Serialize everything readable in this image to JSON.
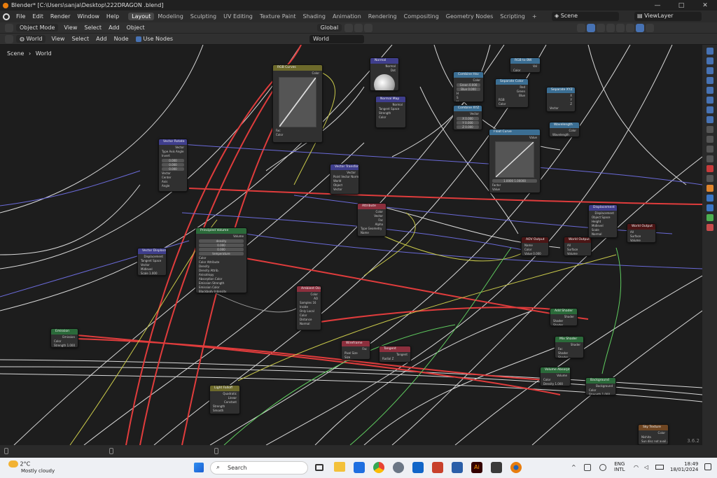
{
  "window": {
    "title": "Blender* [C:\\Users\\sanja\\Desktop\\222DRAGON .blend]",
    "controls": [
      "—",
      "□",
      "✕"
    ]
  },
  "menu": [
    "File",
    "Edit",
    "Render",
    "Window",
    "Help"
  ],
  "workspaces": [
    "Layout",
    "Modeling",
    "Sculpting",
    "UV Editing",
    "Texture Paint",
    "Shading",
    "Animation",
    "Rendering",
    "Compositing",
    "Geometry Nodes",
    "Scripting",
    "+"
  ],
  "active_workspace": "Layout",
  "scene_name": "Scene",
  "view_layer": "ViewLayer",
  "header1": {
    "mode": "Object Mode",
    "items": [
      "View",
      "Select",
      "Add",
      "Object"
    ],
    "orientation": "Global"
  },
  "header2": {
    "shader_type": "World",
    "items": [
      "View",
      "Select",
      "Add",
      "Node"
    ],
    "use_nodes_label": "Use Nodes",
    "world_name": "World"
  },
  "breadcrumb": [
    "Scene",
    "World"
  ],
  "nodes": [
    {
      "id": "rgb-curves",
      "title": "RGB Curves",
      "kind": "h-color",
      "outputs": [
        "Color"
      ],
      "inputs": [
        "Fac",
        "Color"
      ]
    },
    {
      "id": "normal",
      "title": "Normal",
      "kind": "h-vec",
      "outputs": [
        "Normal",
        "Dot"
      ],
      "inputs": [
        "Normal"
      ]
    },
    {
      "id": "normal-map",
      "title": "Normal Map",
      "kind": "h-vec",
      "outputs": [
        "Normal"
      ],
      "fields": [
        "Tangent Space"
      ],
      "inputs": [
        "Strength",
        "Color"
      ]
    },
    {
      "id": "combine-hsv",
      "title": "Combine Hsv",
      "kind": "h-conv",
      "outputs": [
        "Color"
      ],
      "inputs": [
        "H",
        "S",
        "V"
      ],
      "values": [
        "Green  0.000",
        "Blue  0.000"
      ]
    },
    {
      "id": "rgb-bw",
      "title": "RGB to BW",
      "kind": "h-conv",
      "outputs": [
        "Val"
      ],
      "inputs": [
        "Color"
      ]
    },
    {
      "id": "separate-color",
      "title": "Separate Color",
      "kind": "h-conv",
      "outputs": [
        "Red",
        "Green",
        "Blue"
      ],
      "fields": [
        "RGB"
      ],
      "inputs": [
        "Color"
      ]
    },
    {
      "id": "separate-xyz",
      "title": "Separate XYZ",
      "kind": "h-conv",
      "outputs": [
        "X",
        "Y",
        "Z"
      ],
      "inputs": [
        "Vector"
      ]
    },
    {
      "id": "combine-xyz",
      "title": "Combine XYZ",
      "kind": "h-conv",
      "outputs": [
        "Vector"
      ],
      "values": [
        "X  0.000",
        "Y  0.000",
        "Z  0.000"
      ]
    },
    {
      "id": "wavelength",
      "title": "Wavelength",
      "kind": "h-conv",
      "outputs": [
        "Color"
      ],
      "inputs": [
        "Wavelength"
      ]
    },
    {
      "id": "float-curve",
      "title": "Float Curve",
      "kind": "h-conv",
      "outputs": [
        "Value"
      ],
      "inputs": [
        "Factor",
        "Value"
      ],
      "values": [
        "1.0000   1.00000"
      ]
    },
    {
      "id": "vector-rotate",
      "title": "Vector Rotate",
      "kind": "h-vec",
      "outputs": [
        "Vector"
      ],
      "fields": [
        "Type  Axis Angle",
        "Invert"
      ],
      "inputs": [
        "Vector",
        "Center",
        "Axis",
        "Angle"
      ],
      "values": [
        "0.000",
        "0.000",
        "0.000"
      ]
    },
    {
      "id": "vector-transform",
      "title": "Vector Transform",
      "kind": "h-vec",
      "outputs": [
        "Vector"
      ],
      "fields": [
        "Point  Vector  Normal",
        "World",
        "Object"
      ],
      "inputs": [
        "Vector"
      ]
    },
    {
      "id": "attribute",
      "title": "Attribute",
      "kind": "h-input",
      "outputs": [
        "Color",
        "Vector",
        "Fac",
        "Alpha"
      ],
      "fields": [
        "Type  Geometry",
        "Name"
      ]
    },
    {
      "id": "principled-volume",
      "title": "Principled Volume",
      "kind": "h-shader",
      "outputs": [
        "Volume"
      ],
      "inputs": [
        "Color",
        "Color Attribute",
        "Density",
        "Density Attrib.",
        "Anisotropy",
        "Absorption Color",
        "Emission Strength",
        "Emission Color",
        "Blackbody Intensity",
        "Blackbody Tint",
        "Temperature",
        "Temperature"
      ],
      "values": [
        "density",
        "0.000",
        "0.000",
        "temperature"
      ]
    },
    {
      "id": "vector-displacement",
      "title": "Vector Displacement",
      "kind": "h-vec",
      "outputs": [
        "Displacement"
      ],
      "fields": [
        "Tangent Space"
      ],
      "inputs": [
        "Vector",
        "Midlevel",
        "Scale  1.000"
      ]
    },
    {
      "id": "aov-output",
      "title": "AOV Output",
      "kind": "h-out",
      "inputs": [
        "Name",
        "Color",
        "Value  0.000"
      ]
    },
    {
      "id": "world-output-a",
      "title": "World Output",
      "kind": "h-out",
      "inputs": [
        "All",
        "Surface",
        "Volume"
      ]
    },
    {
      "id": "displacement",
      "title": "Displacement",
      "kind": "h-vec",
      "outputs": [
        "Displacement"
      ],
      "fields": [
        "Object Space"
      ],
      "inputs": [
        "Height",
        "Midlevel",
        "Scale",
        "Normal"
      ]
    },
    {
      "id": "world-output-b",
      "title": "World Output",
      "kind": "h-out",
      "inputs": [
        "All",
        "Surface",
        "Volume"
      ]
    },
    {
      "id": "ambient-occlusion",
      "title": "Ambient Occl.",
      "kind": "h-input",
      "outputs": [
        "Color",
        "AO"
      ],
      "fields": [
        "Samples  16",
        "Inside",
        "Only Local"
      ],
      "inputs": [
        "Color",
        "Distance",
        "Normal"
      ]
    },
    {
      "id": "add-shader",
      "title": "Add Shader",
      "kind": "h-shader",
      "outputs": [
        "Shader"
      ],
      "inputs": [
        "Shader",
        "Shader"
      ]
    },
    {
      "id": "emission",
      "title": "Emission",
      "kind": "h-shader",
      "outputs": [
        "Emission"
      ],
      "inputs": [
        "Color",
        "Strength  1.000"
      ]
    },
    {
      "id": "wireframe",
      "title": "Wireframe",
      "kind": "h-input",
      "outputs": [
        "Fac"
      ],
      "fields": [
        "Pixel Size"
      ],
      "inputs": [
        "Size"
      ]
    },
    {
      "id": "tangent",
      "title": "Tangent",
      "kind": "h-input",
      "outputs": [
        "Tangent"
      ],
      "fields": [
        "Radial  Z"
      ]
    },
    {
      "id": "mix-shader",
      "title": "Mix Shader",
      "kind": "h-shader",
      "outputs": [
        "Shader"
      ],
      "inputs": [
        "Fac",
        "Shader",
        "Shader"
      ]
    },
    {
      "id": "volume-absorption",
      "title": "Volume Absorption",
      "kind": "h-shader",
      "outputs": [
        "Volume"
      ],
      "inputs": [
        "Color",
        "Density  1.000"
      ]
    },
    {
      "id": "background",
      "title": "Background",
      "kind": "h-shader",
      "outputs": [
        "Background"
      ],
      "inputs": [
        "Color",
        "Strength  1.000"
      ]
    },
    {
      "id": "light-falloff",
      "title": "Light Falloff",
      "kind": "h-color",
      "outputs": [
        "Quadratic",
        "Linear",
        "Constant"
      ],
      "inputs": [
        "Strength",
        "Smooth"
      ]
    },
    {
      "id": "sky-texture",
      "title": "Sky Texture",
      "kind": "h-tex",
      "outputs": [
        "Color"
      ],
      "fields": [
        "Nishita",
        "Sun disc not avail..."
      ]
    }
  ],
  "version": "3.6.2",
  "taskbar": {
    "weather_temp": "2°C",
    "weather_desc": "Mostly cloudy",
    "search_placeholder": "Search",
    "lang": "ENG",
    "lang_sub": "INTL",
    "time": "18:49",
    "date": "18/01/2024"
  }
}
